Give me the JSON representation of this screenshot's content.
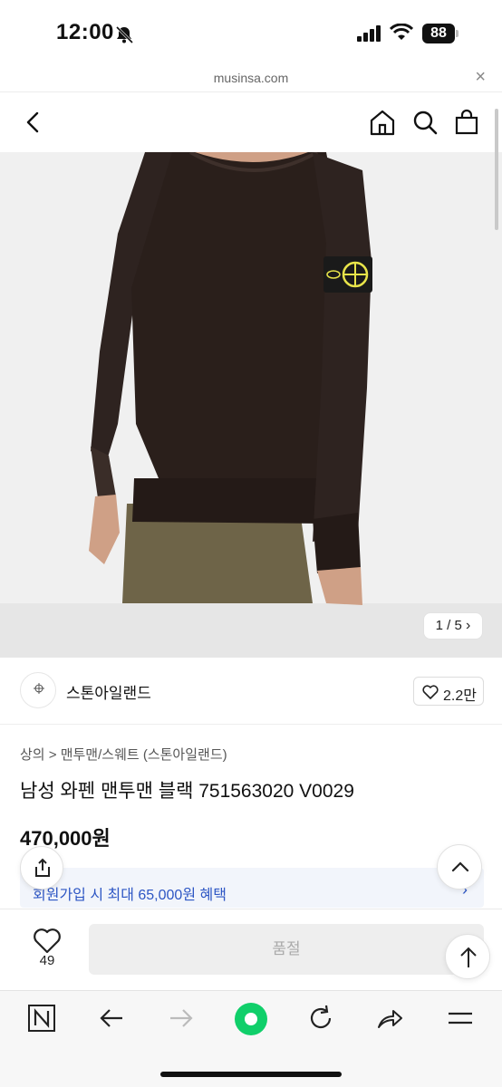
{
  "status_bar": {
    "time": "12:00",
    "battery": "88"
  },
  "url_bar": {
    "url": "musinsa.com",
    "close_label": "×"
  },
  "gallery": {
    "counter": "1 / 5"
  },
  "brand": {
    "name": "스톤아일랜드",
    "logo_text": "STONE ISLAND",
    "like_count": "2.2만"
  },
  "product": {
    "breadcrumb": "상의 > 맨투맨/스웨트 (스톤아일랜드)",
    "title": "남성 와펜 맨투맨 블랙 751563020 V0029",
    "price": "470,000원"
  },
  "benefit": {
    "text": "회원가입 시 최대 65,000원 혜택",
    "arrow": "›"
  },
  "purchase_bar": {
    "heart_count": "49",
    "soldout_label": "품절"
  },
  "colors": {
    "benefit_text": "#2d56c4",
    "benefit_bg": "#f2f5fb",
    "sweater": "#2a1f1b",
    "badge_yellow": "#e8e44a"
  }
}
